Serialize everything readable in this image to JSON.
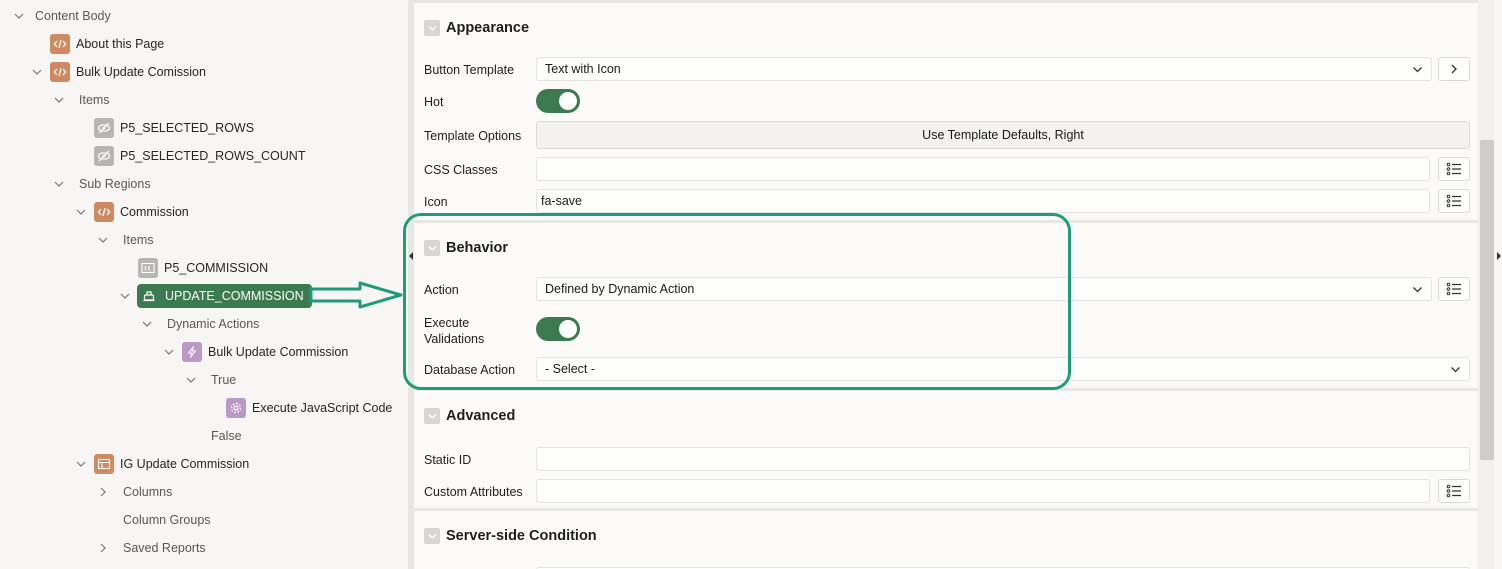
{
  "tree": {
    "content_body": "Content Body",
    "about_page": "About this Page",
    "bulk_update": "Bulk Update Comission",
    "items": "Items",
    "p5_selected_rows": "P5_SELECTED_ROWS",
    "p5_selected_rows_count": "P5_SELECTED_ROWS_COUNT",
    "sub_regions": "Sub Regions",
    "commission": "Commission",
    "commission_items": "Items",
    "p5_commission": "P5_COMMISSION",
    "update_commission": "UPDATE_COMMISSION",
    "dynamic_actions": "Dynamic Actions",
    "bulk_update_commission_da": "Bulk Update Commission",
    "true_label": "True",
    "execute_js": "Execute JavaScript Code",
    "false_label": "False",
    "ig_update_commission": "IG Update Commission",
    "columns": "Columns",
    "column_groups": "Column Groups",
    "saved_reports": "Saved Reports"
  },
  "appearance": {
    "title": "Appearance",
    "button_template_label": "Button Template",
    "button_template_value": "Text with Icon",
    "hot_label": "Hot",
    "template_options_label": "Template Options",
    "template_options_value": "Use Template Defaults, Right",
    "css_classes_label": "CSS Classes",
    "css_classes_value": "",
    "icon_label": "Icon",
    "icon_value": "fa-save"
  },
  "behavior": {
    "title": "Behavior",
    "action_label": "Action",
    "action_value": "Defined by Dynamic Action",
    "execute_validations_label_1": "Execute",
    "execute_validations_label_2": "Validations",
    "database_action_label": "Database Action",
    "database_action_value": "- Select -"
  },
  "advanced": {
    "title": "Advanced",
    "static_id_label": "Static ID",
    "static_id_value": "",
    "custom_attributes_label": "Custom Attributes",
    "custom_attributes_value": ""
  },
  "server_side": {
    "title": "Server-side Condition"
  },
  "colors": {
    "accent_green": "#3c7a4f",
    "highlight_teal": "#1f9b7a",
    "code_icon": "#cf8a62",
    "da_icon": "#b99ac7"
  },
  "toggles": {
    "hot": true,
    "execute_validations": true
  }
}
